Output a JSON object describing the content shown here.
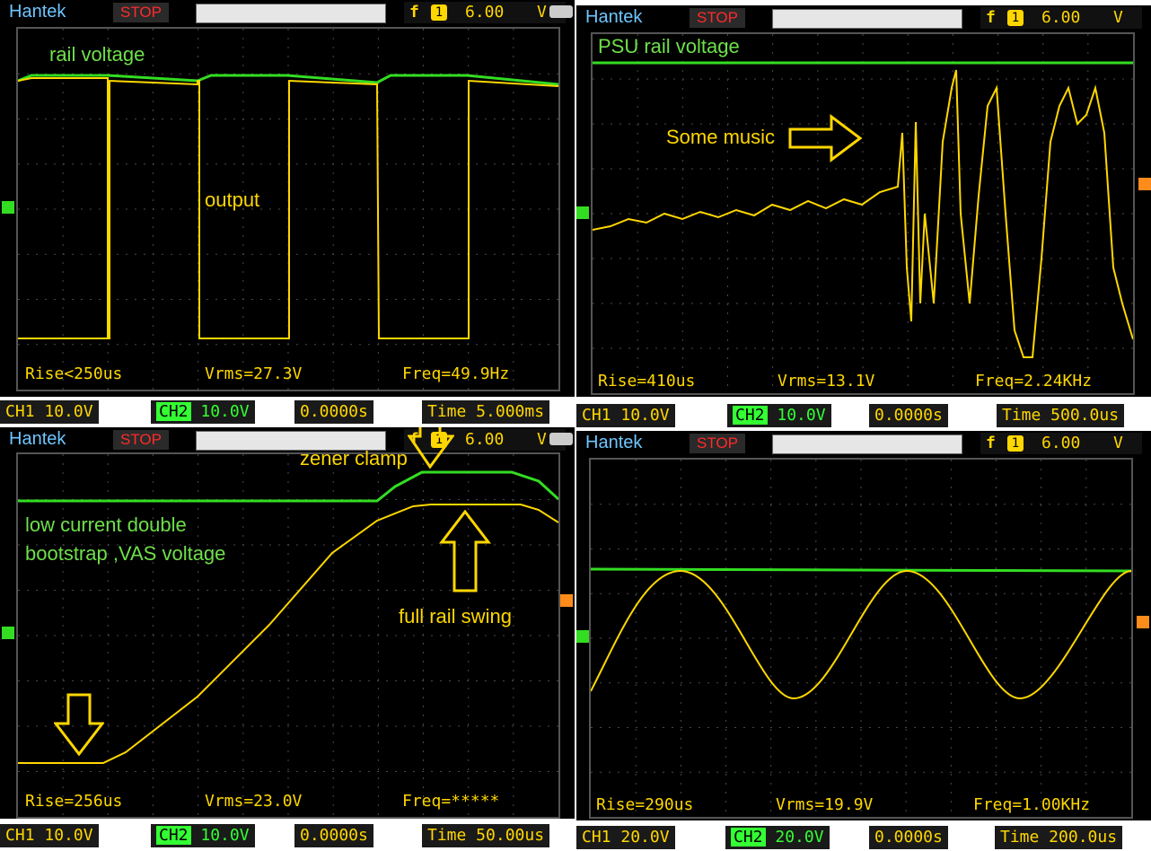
{
  "panels": [
    {
      "brand": "Hantek",
      "state": "STOP",
      "trigger": {
        "icon": "f",
        "channel": "1",
        "level": "6.00",
        "unit": "V"
      },
      "labels": [
        {
          "text": "rail voltage",
          "color": "#6ee04a"
        },
        {
          "text": "output",
          "color": "#ffd700"
        }
      ],
      "measurements": {
        "rise": "Rise<250us",
        "vrms": "Vrms=27.3V",
        "freq": "Freq=49.9Hz"
      },
      "status": {
        "ch1": "CH1",
        "ch1_scale": "10.0V",
        "ch2": "CH2",
        "ch2_scale": "10.0V",
        "trig_pos": "0.0000s",
        "time": "Time 5.000ms"
      }
    },
    {
      "brand": "Hantek",
      "state": "STOP",
      "trigger": {
        "icon": "f",
        "channel": "1",
        "level": "6.00",
        "unit": "V"
      },
      "labels": [
        {
          "text": "PSU rail voltage",
          "color": "#6ee04a"
        },
        {
          "text": "Some music",
          "color": "#ffd700"
        }
      ],
      "measurements": {
        "rise": "Rise=410us",
        "vrms": "Vrms=13.1V",
        "freq": "Freq=2.24KHz"
      },
      "status": {
        "ch1": "CH1",
        "ch1_scale": "10.0V",
        "ch2": "CH2",
        "ch2_scale": "10.0V",
        "trig_pos": "0.0000s",
        "time": "Time 500.0us"
      }
    },
    {
      "brand": "Hantek",
      "state": "STOP",
      "trigger": {
        "icon": "f",
        "channel": "1",
        "level": "6.00",
        "unit": "V"
      },
      "labels": [
        {
          "text": "zener clamp",
          "color": "#ffd700"
        },
        {
          "text": "low current double",
          "color": "#6ee04a"
        },
        {
          "text": "bootstrap ,VAS voltage",
          "color": "#6ee04a"
        },
        {
          "text": "full rail swing",
          "color": "#ffd700"
        }
      ],
      "measurements": {
        "rise": "Rise=256us",
        "vrms": "Vrms=23.0V",
        "freq": "Freq=*****"
      },
      "status": {
        "ch1": "CH1",
        "ch1_scale": "10.0V",
        "ch2": "CH2",
        "ch2_scale": "10.0V",
        "trig_pos": "0.0000s",
        "time": "Time 50.00us"
      }
    },
    {
      "brand": "Hantek",
      "state": "STOP",
      "trigger": {
        "icon": "f",
        "channel": "1",
        "level": "6.00",
        "unit": "V"
      },
      "labels": [],
      "measurements": {
        "rise": "Rise=290us",
        "vrms": "Vrms=19.9V",
        "freq": "Freq=1.00KHz"
      },
      "status": {
        "ch1": "CH1",
        "ch1_scale": "20.0V",
        "ch2": "CH2",
        "ch2_scale": "20.0V",
        "trig_pos": "0.0000s",
        "time": "Time 200.0us"
      }
    }
  ],
  "colors": {
    "ch1": "#ffd700",
    "ch2": "#33dd22",
    "grid": "#4a4a4a",
    "brand": "#6ec6ff",
    "stop": "#ff2a2a"
  }
}
